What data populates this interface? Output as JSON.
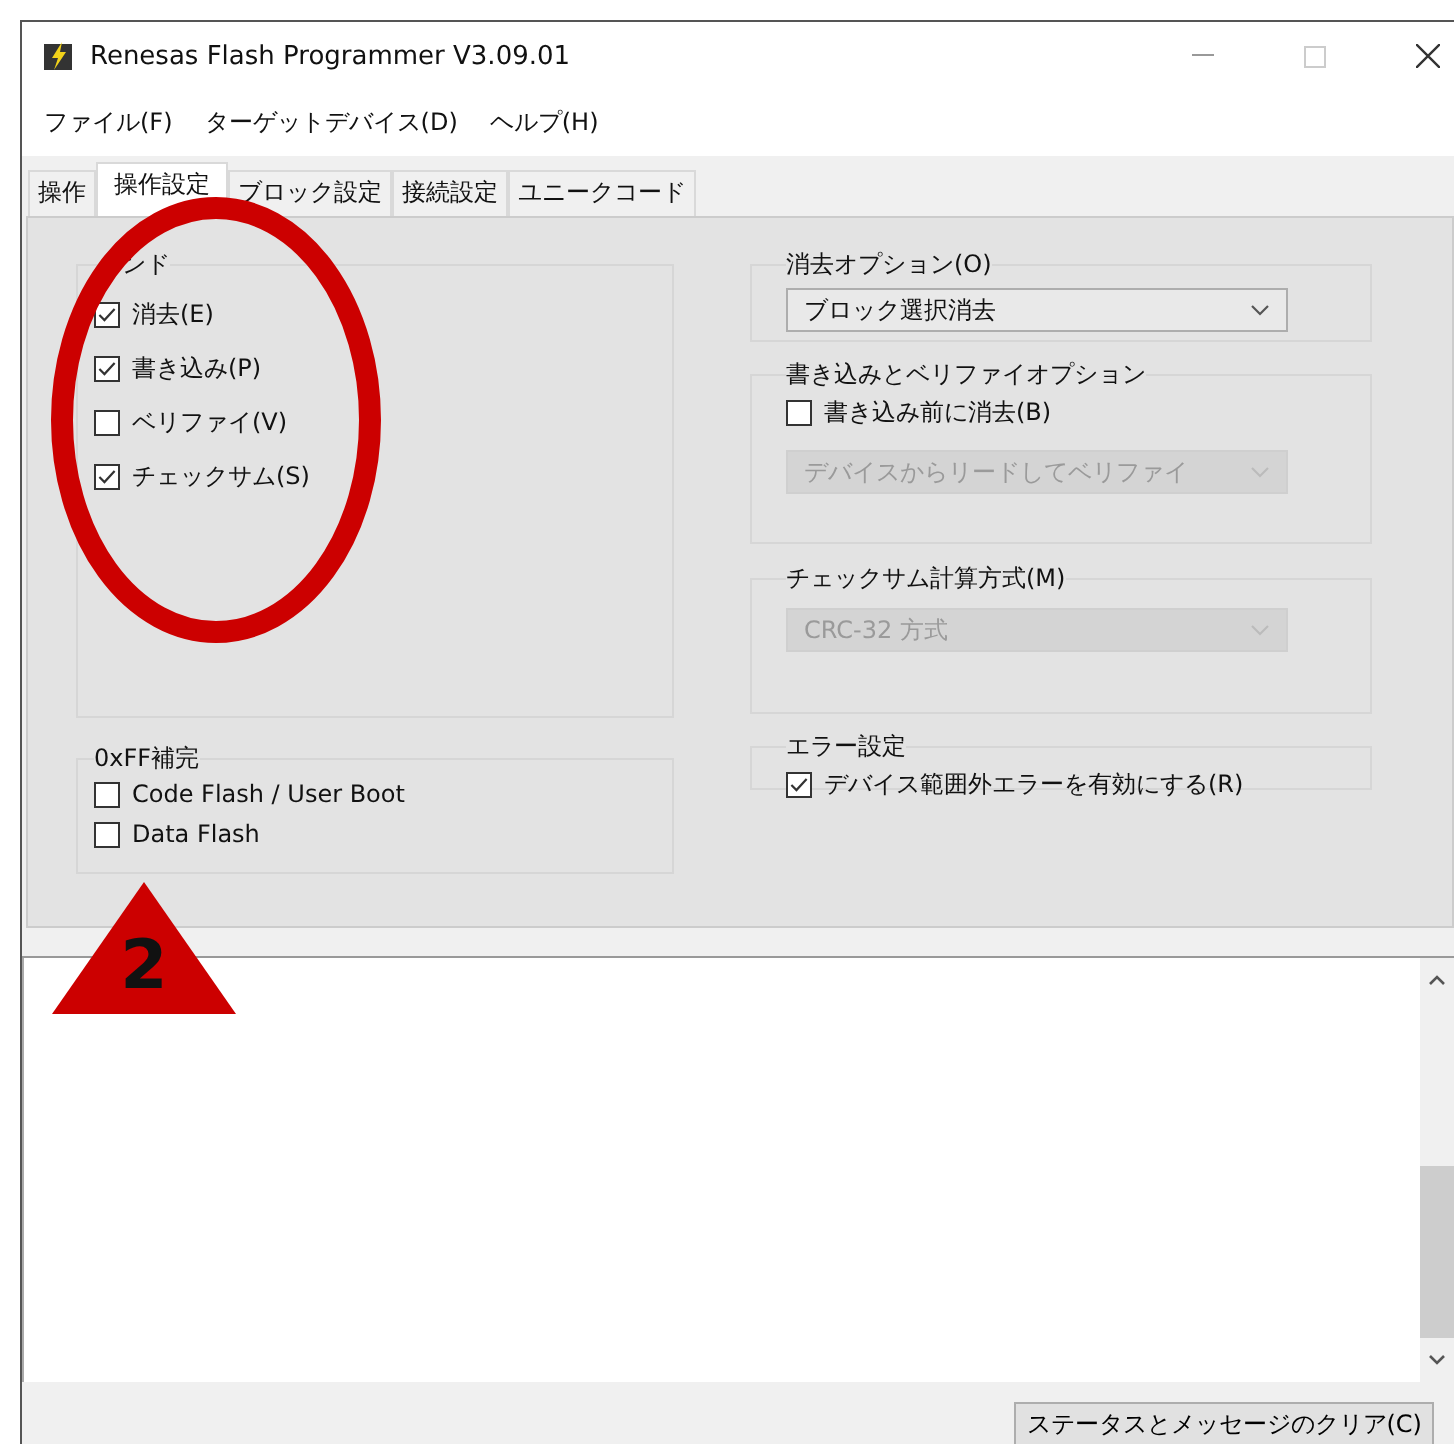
{
  "window": {
    "title": "Renesas Flash Programmer V3.09.01"
  },
  "menu": [
    "ファイル(F)",
    "ターゲットデバイス(D)",
    "ヘルプ(H)"
  ],
  "tabs": [
    {
      "label": "操作",
      "selected": false
    },
    {
      "label": "操作設定",
      "selected": true
    },
    {
      "label": "ブロック設定",
      "selected": false
    },
    {
      "label": "接続設定",
      "selected": false
    },
    {
      "label": "ユニークコード",
      "selected": false
    }
  ],
  "left_groups": [
    {
      "title": "ンド",
      "items": [
        {
          "label": "消去(E)",
          "checked": true
        },
        {
          "label": "書き込み(P)",
          "checked": true
        },
        {
          "label": "ベリファイ(V)",
          "checked": false
        },
        {
          "label": "チェックサム(S)",
          "checked": true
        }
      ]
    },
    {
      "title": "0xFF補完",
      "items": [
        {
          "label": "Code Flash / User Boot",
          "checked": false
        },
        {
          "label": "Data Flash",
          "checked": false
        }
      ]
    }
  ],
  "right_groups": [
    {
      "title": "消去オプション(O)",
      "controls": [
        {
          "kind": "dropdown",
          "value": "ブロック選択消去",
          "disabled": false
        }
      ]
    },
    {
      "title": "書き込みとベリファイオプション",
      "controls": [
        {
          "kind": "checkbox",
          "label": "書き込み前に消去(B)",
          "checked": false
        },
        {
          "kind": "dropdown",
          "value": "デバイスからリードしてベリファイ",
          "disabled": true
        }
      ]
    },
    {
      "title": "チェックサム計算方式(M)",
      "controls": [
        {
          "kind": "dropdown",
          "value": "CRC-32 方式",
          "disabled": true
        }
      ]
    },
    {
      "title": "エラー設定",
      "controls": [
        {
          "kind": "checkbox",
          "label": "デバイス範囲外エラーを有効にする(R)",
          "checked": true
        }
      ]
    }
  ],
  "clear_button": "ステータスとメッセージのクリア(C)",
  "annotations": [
    {
      "kind": "ellipse"
    },
    {
      "kind": "triangle",
      "label": "2"
    }
  ]
}
